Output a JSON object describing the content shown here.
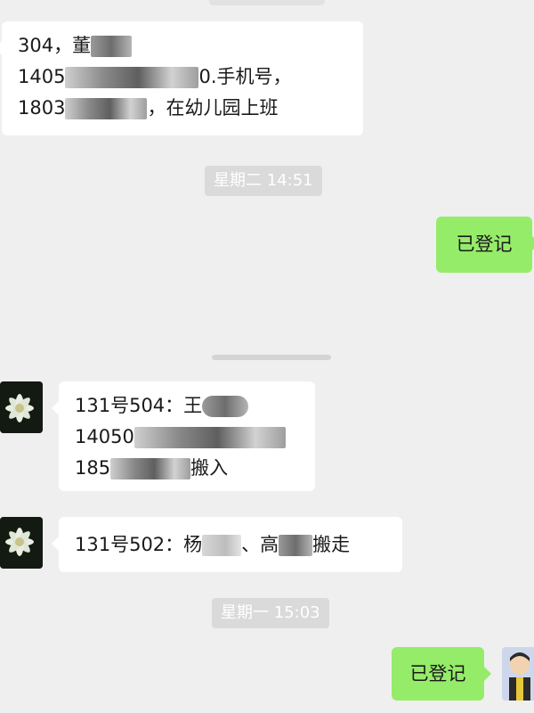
{
  "messages": [
    {
      "lines": [
        {
          "pre": "304，董",
          "post": ""
        },
        {
          "pre": "1405",
          "post": "0.手机号，"
        },
        {
          "pre": "1803",
          "post": "，在幼儿园上班"
        }
      ]
    },
    {
      "timestamp": "星期二 14:51"
    },
    {
      "text": "已登记"
    },
    {
      "lines": [
        {
          "pre": "131号504：王",
          "post": ""
        },
        {
          "pre": "14050",
          "post": ""
        },
        {
          "pre": "185",
          "post": "搬入"
        }
      ]
    },
    {
      "line": {
        "pre": "131号502：杨",
        "mid": "、高",
        "post": "搬走"
      }
    },
    {
      "timestamp": "星期一 15:03"
    },
    {
      "text": "已登记"
    }
  ],
  "colors": {
    "background": "#efefef",
    "incoming_bubble": "#ffffff",
    "outgoing_bubble": "#95ec69",
    "timestamp_bg": "#dadada"
  },
  "icons": {
    "contact_avatar": "cactus-flower-icon",
    "self_avatar": "cartoon-person-icon"
  }
}
